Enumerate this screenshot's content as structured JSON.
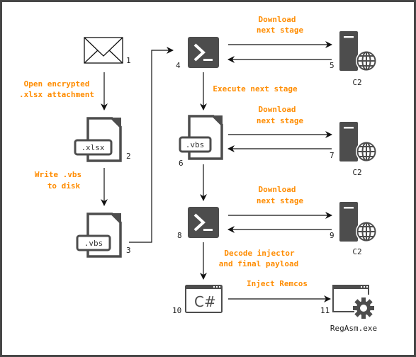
{
  "colors": {
    "label": "#ff8c00",
    "icon": "#4d4d4d",
    "border": "#464646"
  },
  "nodes": [
    {
      "id": "1",
      "icon": "envelope-icon"
    },
    {
      "id": "2",
      "icon": "file-icon",
      "tag": ".xlsx"
    },
    {
      "id": "3",
      "icon": "file-icon",
      "tag": ".vbs"
    },
    {
      "id": "4",
      "icon": "powershell-icon"
    },
    {
      "id": "5",
      "icon": "server-globe-icon",
      "caption": "C2"
    },
    {
      "id": "6",
      "icon": "file-icon",
      "tag": ".vbs"
    },
    {
      "id": "7",
      "icon": "server-globe-icon",
      "caption": "C2"
    },
    {
      "id": "8",
      "icon": "powershell-icon"
    },
    {
      "id": "9",
      "icon": "server-globe-icon",
      "caption": "C2"
    },
    {
      "id": "10",
      "icon": "csharp-window-icon",
      "glyph": "C#"
    },
    {
      "id": "11",
      "icon": "app-gear-window-icon",
      "caption": "RegAsm.exe"
    }
  ],
  "edges": [
    {
      "from": "1",
      "to": "2",
      "label": [
        "Open encrypted",
        ".xlsx attachment"
      ]
    },
    {
      "from": "2",
      "to": "3",
      "label": [
        "Write .vbs",
        "to disk"
      ]
    },
    {
      "from": "3",
      "to": "4",
      "label": []
    },
    {
      "from": "4",
      "to": "5",
      "label": [
        "Download",
        "next stage"
      ]
    },
    {
      "from": "4",
      "to": "6",
      "label": [
        "Execute next stage"
      ]
    },
    {
      "from": "6",
      "to": "7",
      "label": [
        "Download",
        "next stage"
      ]
    },
    {
      "from": "6",
      "to": "8",
      "label": []
    },
    {
      "from": "8",
      "to": "9",
      "label": [
        "Download",
        "next stage"
      ]
    },
    {
      "from": "8",
      "to": "10",
      "label": [
        "Decode injector",
        "and final payload"
      ]
    },
    {
      "from": "10",
      "to": "11",
      "label": [
        "Inject Remcos"
      ]
    }
  ]
}
